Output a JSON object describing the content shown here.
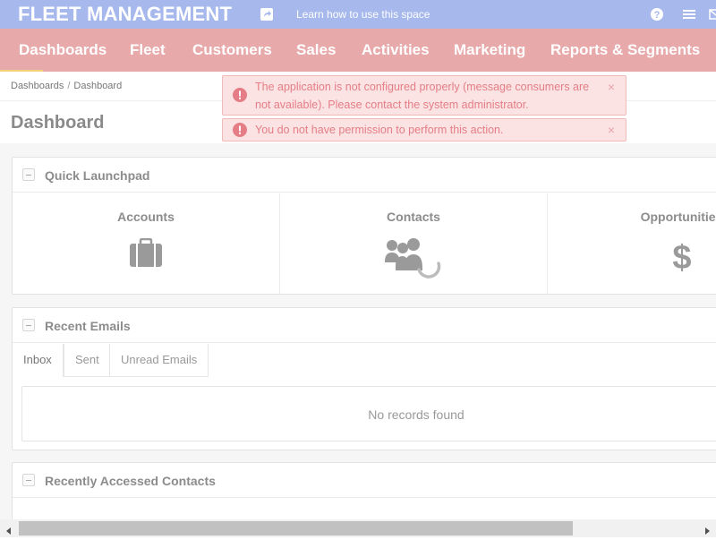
{
  "header": {
    "brand": "FLEET MANAGEMENT",
    "learn_link": "Learn how to use this space",
    "icons": [
      "share-icon",
      "help-icon",
      "menu-icon",
      "mail-icon"
    ]
  },
  "nav": {
    "items": [
      "Dashboards",
      "Fleet",
      "Customers",
      "Sales",
      "Activities",
      "Marketing",
      "Reports & Segments"
    ]
  },
  "breadcrumb": {
    "items": [
      "Dashboards",
      "Dashboard"
    ],
    "separator": "/"
  },
  "page_title": "Dashboard",
  "alerts": [
    {
      "text": "The application is not configured properly (message consumers are not available). Please contact the system administrator.",
      "close": "×"
    },
    {
      "text": "You do not have permission to perform this action.",
      "close": "×"
    }
  ],
  "quick_launchpad": {
    "title": "Quick Launchpad",
    "tiles": [
      {
        "label": "Accounts",
        "icon": "briefcase-icon"
      },
      {
        "label": "Contacts",
        "icon": "users-icon"
      },
      {
        "label": "Opportunities",
        "icon": "dollar-icon"
      }
    ]
  },
  "recent_emails": {
    "title": "Recent Emails",
    "tabs": [
      "Inbox",
      "Sent",
      "Unread Emails"
    ],
    "active_tab": "Inbox",
    "empty_text": "No records found"
  },
  "recent_contacts": {
    "title": "Recently Accessed Contacts"
  },
  "colors": {
    "topbar": "#a6b8ec",
    "navbar": "#e8a9ab",
    "alert_bg": "#fbe3e3",
    "alert_text": "#e57d86"
  }
}
